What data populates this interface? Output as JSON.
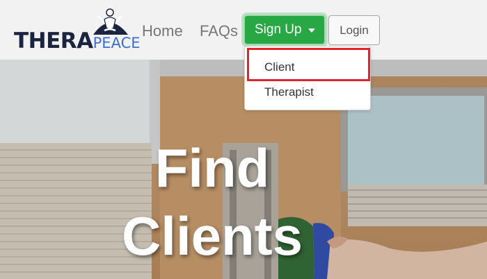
{
  "brand": {
    "part1": "THERA",
    "part2": "PEACE"
  },
  "nav": {
    "home": "Home",
    "faqs": "FAQs",
    "signup": "Sign Up",
    "login": "Login"
  },
  "dropdown": {
    "items": [
      "Client",
      "Therapist"
    ],
    "highlighted": "Client"
  },
  "hero": {
    "line1": "Find",
    "line2": "Clients"
  },
  "colors": {
    "signup_green": "#28a745",
    "highlight_red": "#e3222b",
    "brand_navy": "#1c2340",
    "brand_blue": "#3b6fd6"
  }
}
